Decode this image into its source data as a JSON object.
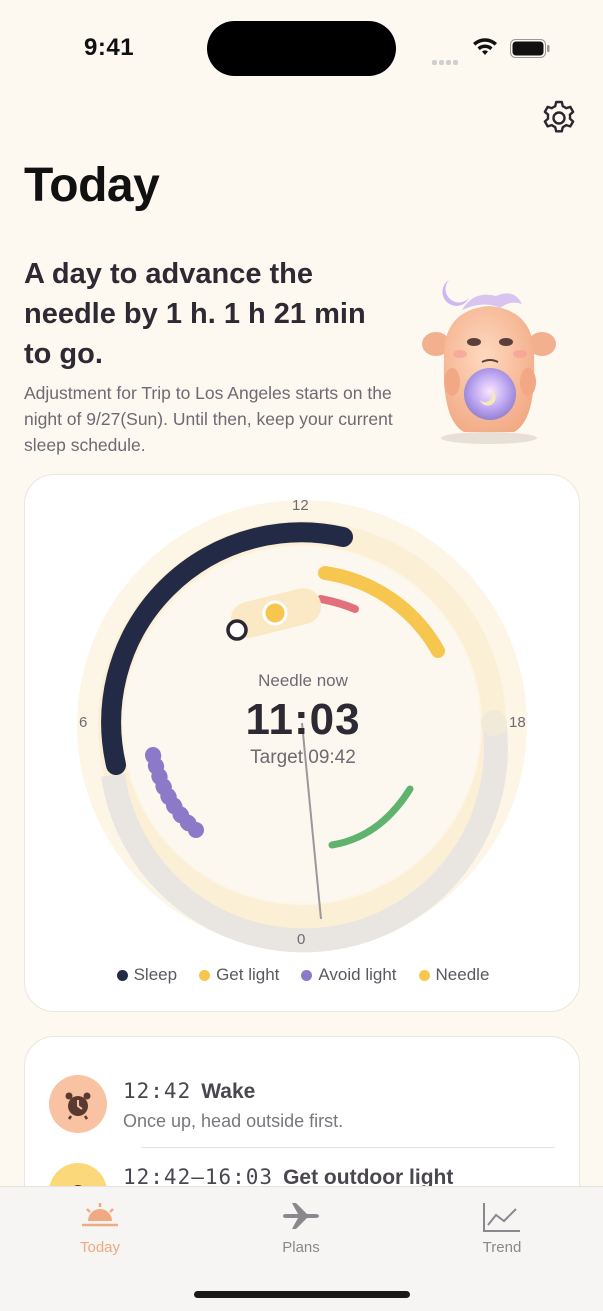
{
  "status_bar": {
    "time": "9:41"
  },
  "header": {
    "title": "Today"
  },
  "summary": {
    "headline": "A day to advance the needle by 1 h. 1 h 21 min to go.",
    "description": "Adjustment for Trip to Los Angeles starts on the night of 9/27(Sun). Until then, keep your current sleep schedule."
  },
  "dial": {
    "tick_top": "12",
    "tick_left": "6",
    "tick_right": "18",
    "tick_bottom": "0",
    "center_label": "Needle now",
    "current_time": "11:03",
    "target": "Target 09:42"
  },
  "legend": [
    {
      "label": "Sleep",
      "color": "#232a45"
    },
    {
      "label": "Get light",
      "color": "#f6c64f"
    },
    {
      "label": "Avoid light",
      "color": "#8c79c8"
    },
    {
      "label": "Needle",
      "color": "#f6c64f"
    }
  ],
  "schedule": [
    {
      "time": "12:42",
      "title": "Wake",
      "description": "Once up, head outside first.",
      "icon": "alarm-clock-icon",
      "icon_color": "#f9c3a3"
    },
    {
      "time": "12:42–16:03",
      "title": "Get outdoor light",
      "description": "",
      "icon": "sun-icon",
      "icon_color": "#fbd97a"
    }
  ],
  "tabs": [
    {
      "label": "Today",
      "icon": "sunrise-icon",
      "active": true
    },
    {
      "label": "Plans",
      "icon": "airplane-icon",
      "active": false
    },
    {
      "label": "Trend",
      "icon": "chart-icon",
      "active": false
    }
  ],
  "colors": {
    "background": "#fdf8f0",
    "sleep": "#232a45",
    "light": "#f6c64f",
    "avoid": "#8c79c8",
    "green_arc": "#5fb36f",
    "red_arc": "#e2707a",
    "accent": "#f1a981"
  }
}
